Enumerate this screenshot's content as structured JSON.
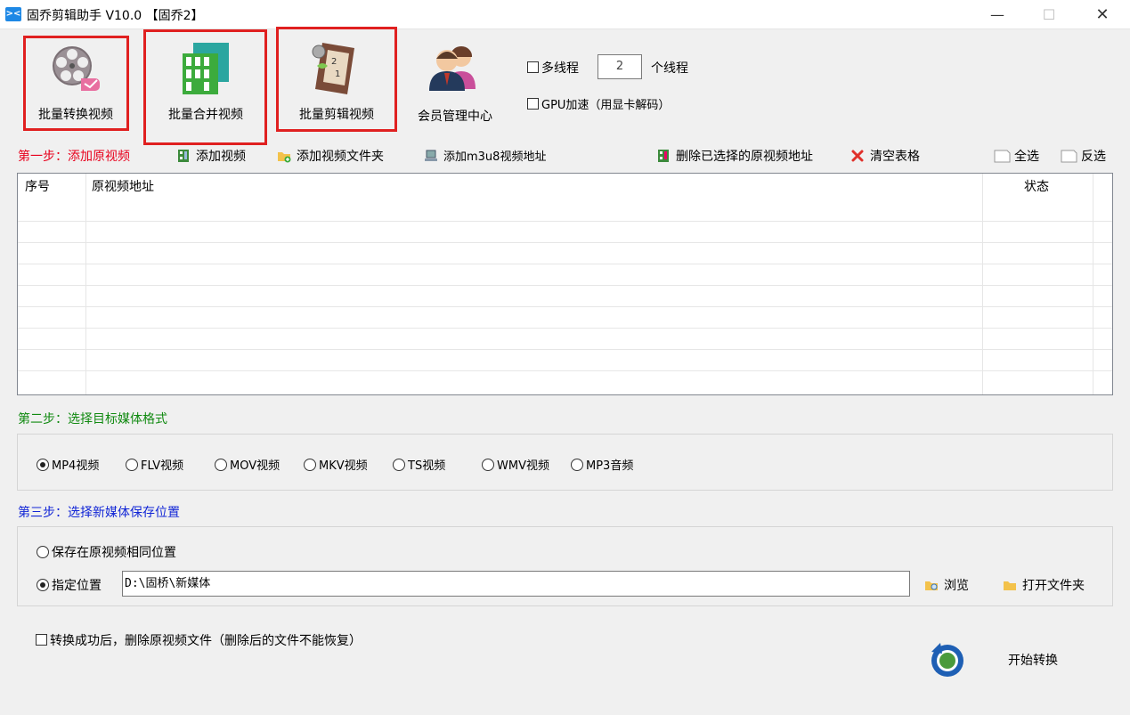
{
  "window": {
    "title": "固乔剪辑助手 V10.0 【固乔2】",
    "app_icon_text": "><",
    "min_glyph": "—",
    "max_glyph": "☐",
    "close_glyph": "✕"
  },
  "toolbar": {
    "batch_convert": "批量转换视频",
    "batch_merge": "批量合并视频",
    "batch_edit": "批量剪辑视频",
    "member_center": "会员管理中心",
    "multithread_label": "多线程",
    "thread_count": "2",
    "thread_unit": "个线程",
    "gpu_label": "GPU加速（用显卡解码）"
  },
  "step1": {
    "label": "第一步：添加原视频",
    "add_video": "添加视频",
    "add_folder": "添加视频文件夹",
    "add_m3u8": "添加m3u8视频地址",
    "delete_selected": "删除已选择的原视频地址",
    "clear_table": "清空表格",
    "select_all": "全选",
    "invert": "反选"
  },
  "table": {
    "columns": [
      "序号",
      "原视频地址",
      "状态"
    ],
    "rows": []
  },
  "step2": {
    "label": "第二步：选择目标媒体格式",
    "formats": [
      "MP4视频",
      "FLV视频",
      "MOV视频",
      "MKV视频",
      "TS视频",
      "WMV视频",
      "MP3音频"
    ],
    "selected": "MP4视频"
  },
  "step3": {
    "label": "第三步：选择新媒体保存位置",
    "same_location": "保存在原视频相同位置",
    "specified_location": "指定位置",
    "path": "D:\\固桥\\新媒体",
    "browse": "浏览",
    "open_folder": "打开文件夹"
  },
  "footer": {
    "delete_after": "转换成功后，删除原视频文件（删除后的文件不能恢复）",
    "start": "开始转换"
  },
  "colors": {
    "step1": "#e8001c",
    "step2": "#118a11",
    "step3": "#1226d6",
    "highlight_box": "#e02020"
  }
}
